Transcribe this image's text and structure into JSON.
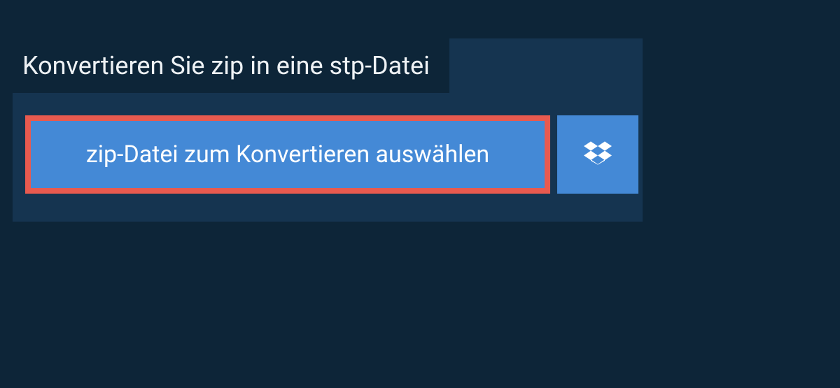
{
  "header": {
    "title": "Konvertieren Sie zip in eine stp-Datei"
  },
  "actions": {
    "select_file_label": "zip-Datei zum Konvertieren auswählen",
    "dropbox_icon": "dropbox-icon"
  },
  "colors": {
    "background": "#0d2538",
    "panel": "#153450",
    "button": "#4489d6",
    "highlight_border": "#e85a4f"
  }
}
